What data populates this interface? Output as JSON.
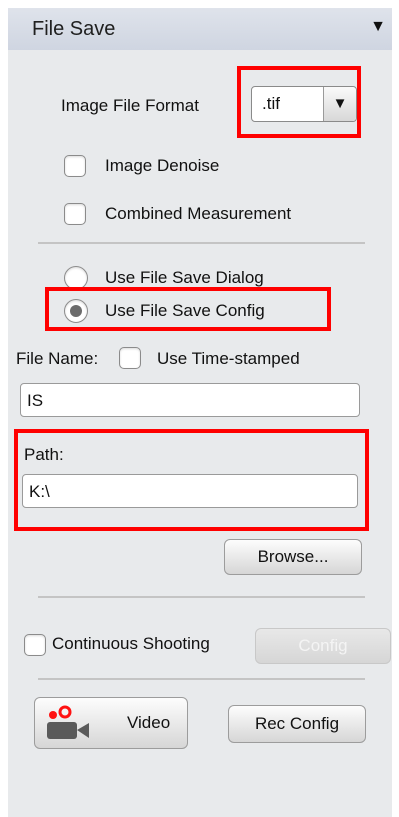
{
  "panel": {
    "title": "File Save",
    "collapse_icon": "triangle-down-icon"
  },
  "format": {
    "label": "Image File Format",
    "value": ".tif",
    "arrow": "▼"
  },
  "options": {
    "denoise": {
      "label": "Image Denoise",
      "checked": false
    },
    "combined": {
      "label": "Combined Measurement",
      "checked": false
    }
  },
  "save_mode": {
    "dialog_label": "Use File Save Dialog",
    "config_label": "Use File Save Config",
    "selected": "config"
  },
  "file_name": {
    "label": "File Name:",
    "timestamp_label": "Use Time-stamped",
    "timestamp_checked": false,
    "value": "IS"
  },
  "path": {
    "label": "Path:",
    "value": "K:\\"
  },
  "browse": {
    "label": "Browse..."
  },
  "continuous": {
    "label": "Continuous Shooting",
    "checked": false,
    "config_label": "Config"
  },
  "video": {
    "label": "Video",
    "icon": "video-camera-icon"
  },
  "rec_config": {
    "label": "Rec Config"
  },
  "highlight_color": "#ff0000"
}
